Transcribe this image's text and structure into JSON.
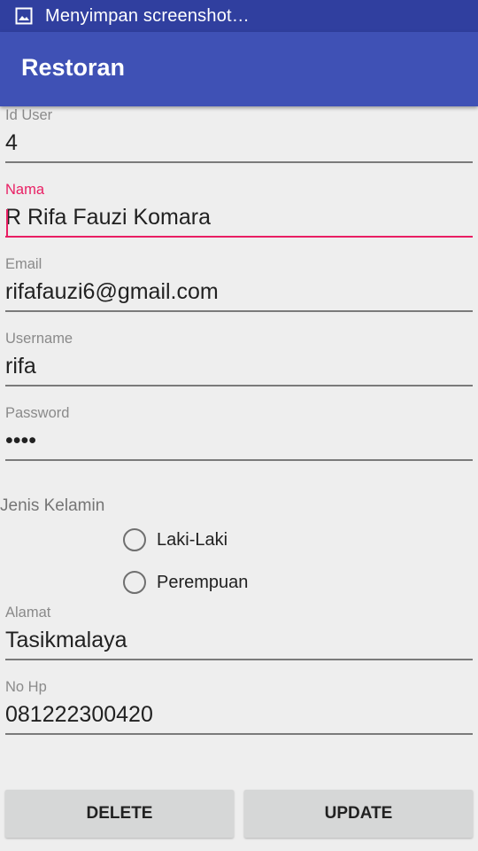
{
  "status_bar": {
    "icon": "image-icon",
    "text": "Menyimpan screenshot…"
  },
  "app_bar": {
    "title": "Restoran"
  },
  "form": {
    "id_user": {
      "label": "Id User",
      "value": "4"
    },
    "nama": {
      "label": "Nama",
      "value": "R Rifa Fauzi Komara"
    },
    "email": {
      "label": "Email",
      "value": "rifafauzi6@gmail.com"
    },
    "username": {
      "label": "Username",
      "value": "rifa"
    },
    "password": {
      "label": "Password",
      "value": "••••"
    },
    "gender": {
      "label": "Jenis Kelamin",
      "options": [
        "Laki-Laki",
        "Perempuan"
      ]
    },
    "alamat": {
      "label": "Alamat",
      "value": "Tasikmalaya"
    },
    "no_hp": {
      "label": "No Hp",
      "value": "081222300420"
    }
  },
  "buttons": {
    "delete": "DELETE",
    "update": "UPDATE"
  },
  "colors": {
    "primary": "#3f51b5",
    "primary_dark": "#303f9f",
    "accent": "#e91e63"
  }
}
